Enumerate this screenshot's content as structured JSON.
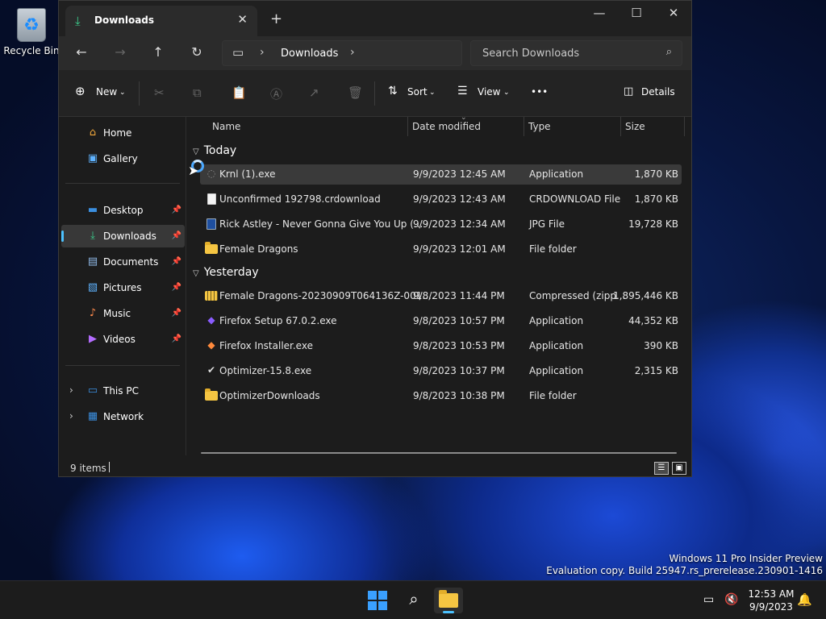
{
  "desktop": {
    "recycle_bin_label": "Recycle Bin",
    "watermark_line1": "Windows 11 Pro Insider Preview",
    "watermark_line2": "Evaluation copy. Build 25947.rs_prerelease.230901-1416"
  },
  "window": {
    "tab_title": "Downloads",
    "new_tab": "+",
    "minimize": "—",
    "maximize": "☐",
    "close": "✕"
  },
  "address": {
    "crumb": "Downloads",
    "search_placeholder": "Search Downloads"
  },
  "commandbar": {
    "new_label": "New",
    "sort_label": "Sort",
    "view_label": "View",
    "more_label": "•••",
    "details_label": "Details"
  },
  "navpane": {
    "items": [
      {
        "label": "Home"
      },
      {
        "label": "Gallery"
      },
      {
        "label": "Desktop"
      },
      {
        "label": "Downloads"
      },
      {
        "label": "Documents"
      },
      {
        "label": "Pictures"
      },
      {
        "label": "Music"
      },
      {
        "label": "Videos"
      },
      {
        "label": "This PC"
      },
      {
        "label": "Network"
      }
    ]
  },
  "columns": {
    "name": "Name",
    "date": "Date modified",
    "type": "Type",
    "size": "Size"
  },
  "groups": {
    "today": "Today",
    "yesterday": "Yesterday"
  },
  "files": [
    {
      "name": "Krnl (1).exe",
      "date": "9/9/2023 12:45 AM",
      "type": "Application",
      "size": "1,870 KB"
    },
    {
      "name": "Unconfirmed 192798.crdownload",
      "date": "9/9/2023 12:43 AM",
      "type": "CRDOWNLOAD File",
      "size": "1,870 KB"
    },
    {
      "name": "Rick Astley - Never Gonna Give You Up (...",
      "date": "9/9/2023 12:34 AM",
      "type": "JPG File",
      "size": "19,728 KB"
    },
    {
      "name": "Female Dragons",
      "date": "9/9/2023 12:01 AM",
      "type": "File folder",
      "size": ""
    },
    {
      "name": "Female Dragons-20230909T064136Z-001....",
      "date": "9/8/2023 11:44 PM",
      "type": "Compressed (zipp...",
      "size": "1,895,446 KB"
    },
    {
      "name": "Firefox Setup 67.0.2.exe",
      "date": "9/8/2023 10:57 PM",
      "type": "Application",
      "size": "44,352 KB"
    },
    {
      "name": "Firefox Installer.exe",
      "date": "9/8/2023 10:53 PM",
      "type": "Application",
      "size": "390 KB"
    },
    {
      "name": "Optimizer-15.8.exe",
      "date": "9/8/2023 10:37 PM",
      "type": "Application",
      "size": "2,315 KB"
    },
    {
      "name": "OptimizerDownloads",
      "date": "9/8/2023 10:38 PM",
      "type": "File folder",
      "size": ""
    }
  ],
  "status": {
    "item_count": "9 items"
  },
  "taskbar": {
    "time": "12:53 AM",
    "date": "9/9/2023"
  }
}
